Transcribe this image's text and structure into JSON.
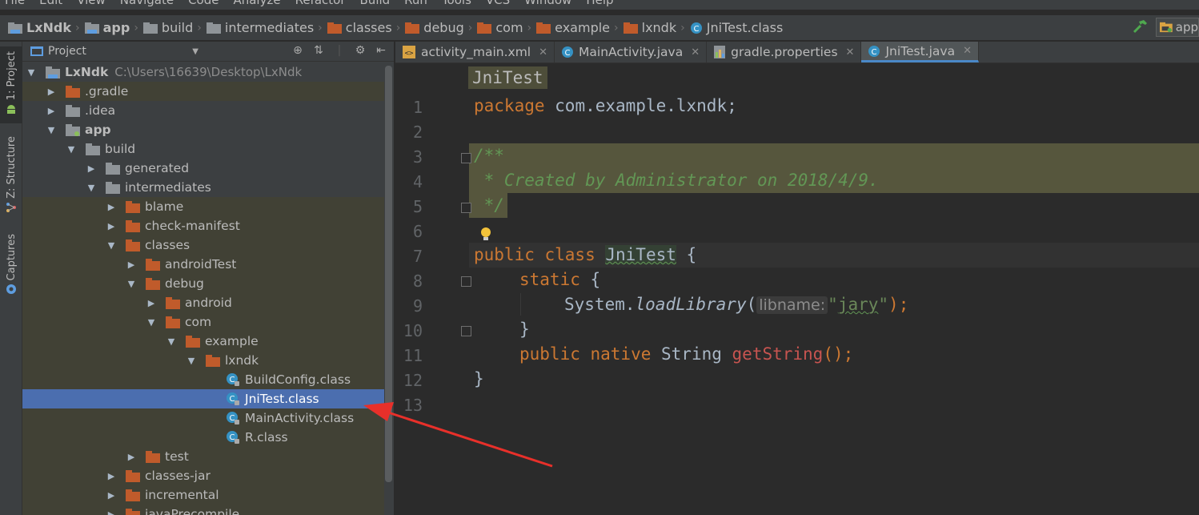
{
  "menu": [
    "File",
    "Edit",
    "View",
    "Navigate",
    "Code",
    "Analyze",
    "Refactor",
    "Build",
    "Run",
    "Tools",
    "VCS",
    "Window",
    "Help"
  ],
  "breadcrumbs": [
    "LxNdk",
    "app",
    "build",
    "intermediates",
    "classes",
    "debug",
    "com",
    "example",
    "lxndk",
    "JniTest.class"
  ],
  "run_config": "app",
  "tool_windows": {
    "project": "1: Project",
    "structure": "Z: Structure",
    "captures": "Captures"
  },
  "project_panel": {
    "view_selector": "Project"
  },
  "tree": [
    {
      "label": "LxNdk",
      "path": "C:\\Users\\16639\\Desktop\\LxNdk",
      "level": 0,
      "state": "open",
      "kind": "module",
      "bold": true,
      "hl": false,
      "sel": false
    },
    {
      "label": ".gradle",
      "level": 1,
      "state": "closed",
      "kind": "folder-orange",
      "hl": true
    },
    {
      "label": ".idea",
      "level": 1,
      "state": "closed",
      "kind": "folder-gray"
    },
    {
      "label": "app",
      "level": 1,
      "state": "open",
      "kind": "module",
      "bold": true
    },
    {
      "label": "build",
      "level": 2,
      "state": "open",
      "kind": "folder-gray"
    },
    {
      "label": "generated",
      "level": 3,
      "state": "closed",
      "kind": "folder-gray"
    },
    {
      "label": "intermediates",
      "level": 3,
      "state": "open",
      "kind": "folder-gray"
    },
    {
      "label": "blame",
      "level": 4,
      "state": "closed",
      "kind": "folder-orange",
      "hl": true
    },
    {
      "label": "check-manifest",
      "level": 4,
      "state": "closed",
      "kind": "folder-orange",
      "hl": true
    },
    {
      "label": "classes",
      "level": 4,
      "state": "open",
      "kind": "folder-orange",
      "hl": true
    },
    {
      "label": "androidTest",
      "level": 5,
      "state": "closed",
      "kind": "folder-orange",
      "hl": true
    },
    {
      "label": "debug",
      "level": 5,
      "state": "open",
      "kind": "folder-orange",
      "hl": true
    },
    {
      "label": "android",
      "level": 6,
      "state": "closed",
      "kind": "folder-orange",
      "hl": true
    },
    {
      "label": "com",
      "level": 6,
      "state": "open",
      "kind": "folder-orange",
      "hl": true
    },
    {
      "label": "example",
      "level": 7,
      "state": "open",
      "kind": "folder-orange",
      "hl": true
    },
    {
      "label": "lxndk",
      "level": 8,
      "state": "open",
      "kind": "folder-orange",
      "hl": true
    },
    {
      "label": "BuildConfig.class",
      "level": 9,
      "state": "none",
      "kind": "class",
      "hl": true
    },
    {
      "label": "JniTest.class",
      "level": 9,
      "state": "none",
      "kind": "class",
      "sel": true
    },
    {
      "label": "MainActivity.class",
      "level": 9,
      "state": "none",
      "kind": "class",
      "hl": true
    },
    {
      "label": "R.class",
      "level": 9,
      "state": "none",
      "kind": "class",
      "hl": true
    },
    {
      "label": "test",
      "level": 5,
      "state": "closed",
      "kind": "folder-orange",
      "hl": true
    },
    {
      "label": "classes-jar",
      "level": 4,
      "state": "closed",
      "kind": "folder-orange",
      "hl": true
    },
    {
      "label": "incremental",
      "level": 4,
      "state": "closed",
      "kind": "folder-orange",
      "hl": true
    },
    {
      "label": "javaPrecompile",
      "level": 4,
      "state": "closed",
      "kind": "folder-orange",
      "hl": true
    }
  ],
  "tabs": [
    {
      "label": "activity_main.xml",
      "icon": "xml-icon",
      "active": false
    },
    {
      "label": "MainActivity.java",
      "icon": "class-icon",
      "active": false
    },
    {
      "label": "gradle.properties",
      "icon": "gradle-icon",
      "active": false
    },
    {
      "label": "JniTest.java",
      "icon": "class-icon",
      "active": true
    }
  ],
  "editor": {
    "class_chip": "JniTest",
    "line_numbers": [
      "1",
      "2",
      "3",
      "4",
      "5",
      "6",
      "7",
      "8",
      "9",
      "10",
      "11",
      "12",
      "13"
    ],
    "code": {
      "l1_kw": "package",
      "l1_rest": " com.example.lxndk;",
      "l3": "/**",
      "l4": " * Created by Administrator on 2018/4/9.",
      "l5": " */",
      "l7_kw": "public class ",
      "l7_cls": "JniTest",
      "l7_rest": " {",
      "l8_kw": "static",
      "l8_rest": " {",
      "l9_a": "System.",
      "l9_fn": "loadLibrary",
      "l9_paren": "(",
      "l9_hint": "libname:",
      "l9_str_q1": "\"",
      "l9_str": "jary",
      "l9_str_q2": "\"",
      "l9_end": ");",
      "l10": "}",
      "l11_kw": "public native ",
      "l11_type": "String ",
      "l11_fn": "getString",
      "l11_end": "();",
      "l12": "}"
    }
  },
  "colors": {
    "selection": "#4b6eaf",
    "folder_orange": "#c05b2b",
    "folder_gray": "#8f9498",
    "keyword": "#cc7832",
    "doc_comment": "#629755",
    "annotation_arrow": "#e8302a"
  }
}
